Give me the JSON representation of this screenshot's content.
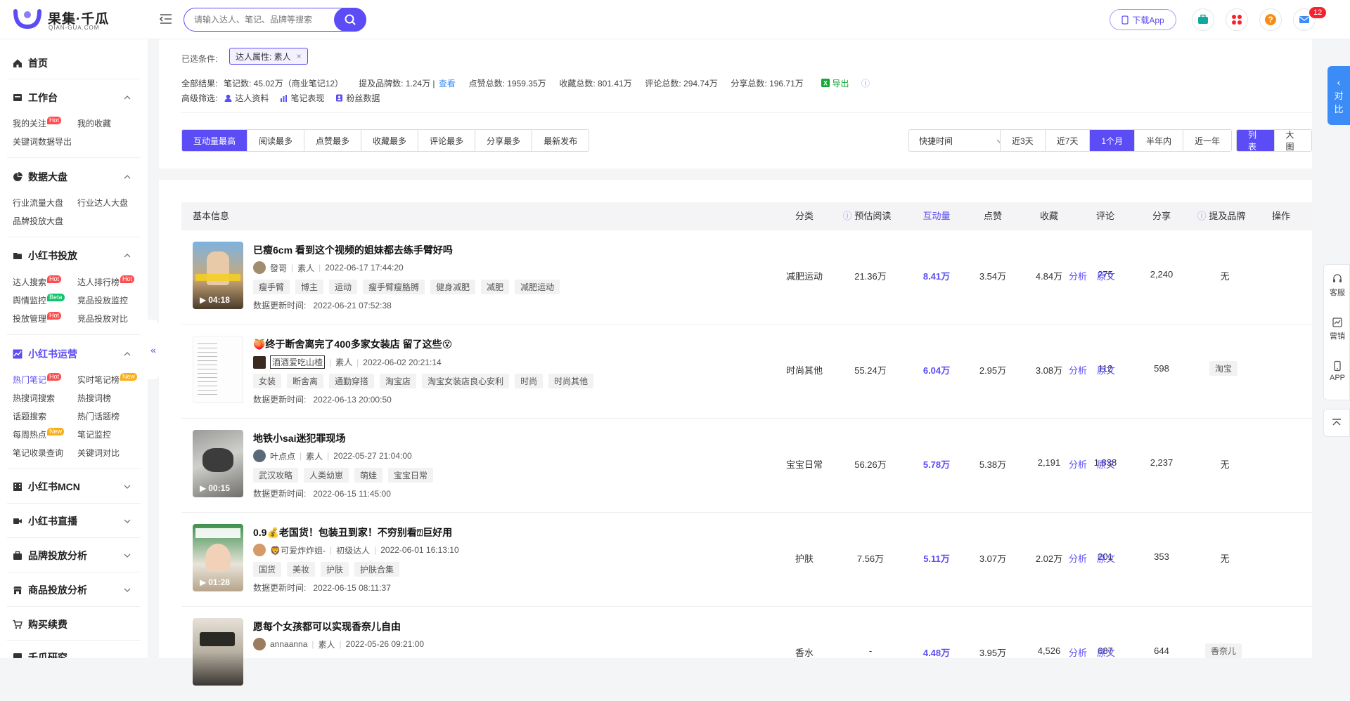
{
  "header": {
    "logo_title": "果集·千瓜",
    "logo_sub": "QIAN-GUA.COM",
    "search_placeholder": "请输入达人、笔记、品牌等搜索",
    "download_app": "下载App",
    "notif_count": "12",
    "accent": "#5b4cf5"
  },
  "sidebar": {
    "home": "首页",
    "workbench": {
      "label": "工作台",
      "items": [
        "我的关注",
        "我的收藏",
        "关键词数据导出"
      ],
      "hot": "Hot"
    },
    "dashboard": {
      "label": "数据大盘",
      "items": [
        "行业流量大盘",
        "行业达人大盘",
        "品牌投放大盘"
      ]
    },
    "xhs_ads": {
      "label": "小红书投放",
      "items": [
        "达人搜索",
        "达人排行榜",
        "舆情监控",
        "竞品投放监控",
        "投放管理",
        "竞品投放对比"
      ],
      "beta": "Beta"
    },
    "xhs_ops": {
      "label": "小红书运营",
      "items": [
        "热门笔记",
        "实时笔记榜",
        "热搜词搜索",
        "热搜词榜",
        "话题搜索",
        "热门话题榜",
        "每周热点",
        "笔记监控",
        "笔记收录查询",
        "关键词对比"
      ],
      "new": "New"
    },
    "mcn": "小红书MCN",
    "live": "小红书直播",
    "brand": "品牌投放分析",
    "goods": "商品投放分析",
    "buy": "购买续费",
    "more": "千瓜研究"
  },
  "filters": {
    "selected_label": "已选条件:",
    "chip": "达人属性: 素人",
    "stats": {
      "all": "全部结果:",
      "notes": "笔记数: 45.02万（商业笔记12）",
      "brands": "提及品牌数: 1.24万 |",
      "view": "查看",
      "likes": "点赞总数: 1959.35万",
      "favs": "收藏总数: 801.41万",
      "comments": "评论总数: 294.74万",
      "shares": "分享总数: 196.71万",
      "export": "导出"
    },
    "adv_label": "高级筛选:",
    "adv": [
      "达人资料",
      "笔记表现",
      "粉丝数据"
    ],
    "sort": [
      "互动量最高",
      "阅读最多",
      "点赞最多",
      "收藏最多",
      "评论最多",
      "分享最多",
      "最新发布"
    ],
    "quick_time": "快捷时间",
    "ranges": [
      "近3天",
      "近7天",
      "1个月",
      "半年内",
      "近一年"
    ],
    "views": [
      "列表",
      "大图"
    ]
  },
  "table": {
    "headers": {
      "info": "基本信息",
      "cat": "分类",
      "reads": "预估阅读",
      "inter": "互动量",
      "likes": "点赞",
      "favs": "收藏",
      "comments": "评论",
      "shares": "分享",
      "brand": "提及品牌",
      "ops": "操作"
    },
    "analyze": "分析",
    "origin": "原文",
    "update_prefix": "数据更新时间:",
    "rows": [
      {
        "title": "已瘦6cm 看到这个视频的姐妹都去练手臂好吗",
        "author": "發哥",
        "level": "素人",
        "time": "2022-06-17 17:44:20",
        "tags": [
          "瘦手臂",
          "博主",
          "运动",
          "瘦手臂瘦胳膊",
          "健身减肥",
          "减肥",
          "减肥运动"
        ],
        "updated": "2022-06-21 07:52:38",
        "duration": "04:18",
        "category": "减肥运动",
        "reads": "21.36万",
        "interactions": "8.41万",
        "likes": "3.54万",
        "favs": "4.84万",
        "comments": "275",
        "shares": "2,240",
        "brand": "无"
      },
      {
        "title": "🍑终于断舍离完了400多家女装店 留了这些😵",
        "author": "酒酒爱吃山楂",
        "level": "素人",
        "time": "2022-06-02 20:21:14",
        "tags": [
          "女装",
          "断舍离",
          "通勤穿搭",
          "淘宝店",
          "淘宝女装店良心安利",
          "时尚",
          "时尚其他"
        ],
        "updated": "2022-06-13 20:00:50",
        "duration": "",
        "category": "时尚其他",
        "reads": "55.24万",
        "interactions": "6.04万",
        "likes": "2.95万",
        "favs": "3.08万",
        "comments": "112",
        "shares": "598",
        "brand": "淘宝"
      },
      {
        "title": "地铁小sai迷犯罪现场",
        "author": "叶点点",
        "level": "素人",
        "time": "2022-05-27 21:04:00",
        "tags": [
          "武汉攻略",
          "人类幼崽",
          "萌娃",
          "宝宝日常"
        ],
        "updated": "2022-06-15 11:45:00",
        "duration": "00:15",
        "category": "宝宝日常",
        "reads": "56.26万",
        "interactions": "5.78万",
        "likes": "5.38万",
        "favs": "2,191",
        "comments": "1,838",
        "shares": "2,237",
        "brand": "无"
      },
      {
        "title": "0.9💰老国货！包装丑到家！不穷别看⍰巨好用",
        "author": "🦁可爱炸炸姐-",
        "level": "初级达人",
        "time": "2022-06-01 16:13:10",
        "tags": [
          "国货",
          "美妆",
          "护肤",
          "护肤合集"
        ],
        "updated": "2022-06-15 08:11:37",
        "duration": "01:28",
        "category": "护肤",
        "reads": "7.56万",
        "interactions": "5.11万",
        "likes": "3.07万",
        "favs": "2.02万",
        "comments": "201",
        "shares": "353",
        "brand": "无"
      },
      {
        "title": "愿每个女孩都可以实现香奈儿自由",
        "author": "annaanna",
        "level": "素人",
        "time": "2022-05-26 09:21:00",
        "tags": [],
        "updated": "",
        "duration": "",
        "category": "香水",
        "reads": "-",
        "interactions": "4.48万",
        "likes": "3.95万",
        "favs": "4,526",
        "comments": "687",
        "shares": "644",
        "brand": "香奈儿"
      }
    ]
  },
  "float": {
    "compare": [
      "对",
      "比"
    ],
    "service": "客服",
    "marketing": "营销",
    "app": "APP"
  }
}
